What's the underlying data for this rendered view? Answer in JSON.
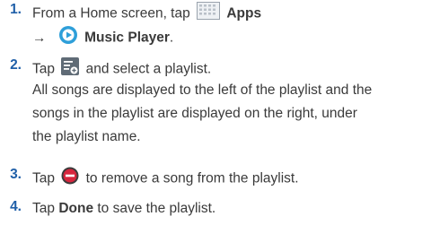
{
  "steps": [
    {
      "number": "1.",
      "line1_prefix": "From a Home screen, tap",
      "apps_label": "Apps",
      "arrow": "→",
      "music_label": "Music Player",
      "music_suffix": ".",
      "icons": [
        "apps-grid-icon",
        "music-player-icon"
      ]
    },
    {
      "number": "2.",
      "prefix": "Tap",
      "suffix": "and select a playlist.",
      "icon": "add-playlist-icon",
      "paragraph": [
        "All songs are displayed to the left of the playlist and the",
        "songs in the playlist are displayed on the right, under",
        "the playlist name."
      ]
    },
    {
      "number": "3.",
      "prefix": "Tap",
      "suffix": "to remove a song from the playlist.",
      "icon": "remove-icon"
    },
    {
      "number": "4.",
      "prefix": "Tap",
      "bold_label": "Done",
      "suffix": "to save the playlist."
    }
  ],
  "colors": {
    "number": "#1f5fa8",
    "text": "#3a3a3a",
    "remove_icon": "#d7263d",
    "music_icon": "#2e9fd9"
  }
}
